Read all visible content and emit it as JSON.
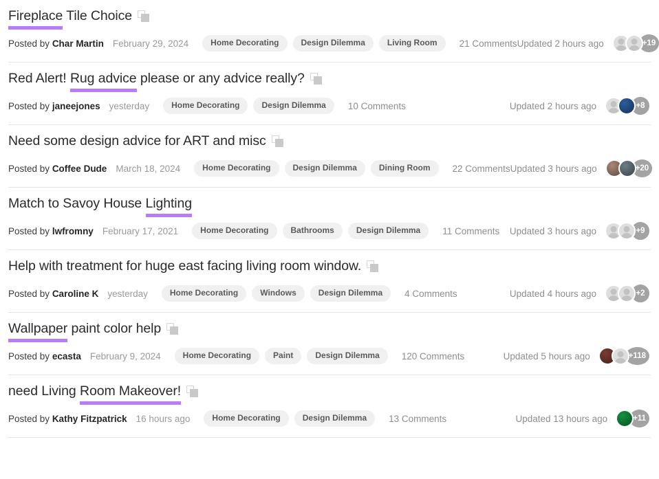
{
  "colors": {
    "highlight_underline": "#b97cf7",
    "tag_background": "#f0f0f0",
    "tag_text": "#5a5a5a",
    "muted_text": "#8e8e8e",
    "title_text": "#2b2b2b",
    "divider": "#e4e4e4",
    "avatar_placeholder": "#dedede",
    "more_count_background": "#a3a3a3"
  },
  "labels": {
    "posted_by_prefix": "Posted by",
    "copy_icon_name": "copy-icon"
  },
  "threads": [
    {
      "title_before": "",
      "title_highlight": "Fireplace",
      "title_after": " Tile Choice",
      "has_copy_icon": true,
      "author": "Char Martin",
      "date": "February 29, 2024",
      "tags": [
        "Home Decorating",
        "Design Dilemma",
        "Living Room"
      ],
      "comments": "21 Comments",
      "updated": "Updated 2 hours ago",
      "avatars": [
        {
          "type": "placeholder",
          "color": "#dedede"
        },
        {
          "type": "placeholder",
          "color": "#dedede"
        }
      ],
      "more_count": "+19"
    },
    {
      "title_before": "Red Alert! ",
      "title_highlight": "Rug advice",
      "title_after": " please or any advice really?",
      "has_copy_icon": true,
      "author": "janeejones",
      "date": "yesterday",
      "tags": [
        "Home Decorating",
        "Design Dilemma"
      ],
      "comments": "10 Comments",
      "updated": "Updated 2 hours ago",
      "avatars": [
        {
          "type": "placeholder",
          "color": "#dedede"
        },
        {
          "type": "photo",
          "color": "#2b5d9c"
        }
      ],
      "more_count": "+8"
    },
    {
      "title_before": "",
      "title_highlight": "",
      "title_after": "Need some design advice for ART and misc",
      "has_copy_icon": true,
      "author": "Coffee Dude",
      "date": "March 18, 2024",
      "tags": [
        "Home Decorating",
        "Design Dilemma",
        "Dining Room"
      ],
      "comments": "22 Comments",
      "updated": "Updated 3 hours ago",
      "avatars": [
        {
          "type": "photo",
          "color": "#a98875"
        },
        {
          "type": "photo",
          "color": "#6d7d84"
        }
      ],
      "more_count": "+20"
    },
    {
      "title_before": "Match to Savoy House ",
      "title_highlight": "Lighting",
      "title_after": "",
      "has_copy_icon": false,
      "author": "lwfromny",
      "date": "February 17, 2021",
      "tags": [
        "Home Decorating",
        "Bathrooms",
        "Design Dilemma"
      ],
      "comments": "11 Comments",
      "updated": "Updated 3 hours ago",
      "avatars": [
        {
          "type": "placeholder",
          "color": "#dedede"
        },
        {
          "type": "placeholder",
          "color": "#dedede"
        }
      ],
      "more_count": "+9"
    },
    {
      "title_before": "",
      "title_highlight": "",
      "title_after": "Help with treatment for huge east facing living room window.",
      "has_copy_icon": true,
      "author": "Caroline K",
      "date": "yesterday",
      "tags": [
        "Home Decorating",
        "Windows",
        "Design Dilemma"
      ],
      "comments": "4 Comments",
      "updated": "Updated 4 hours ago",
      "avatars": [
        {
          "type": "placeholder",
          "color": "#dedede"
        },
        {
          "type": "placeholder",
          "color": "#dedede"
        }
      ],
      "more_count": "+2"
    },
    {
      "title_before": "",
      "title_highlight": "Wallpaper",
      "title_after": " paint color help",
      "has_copy_icon": true,
      "author": "ecasta",
      "date": "February 9, 2024",
      "tags": [
        "Home Decorating",
        "Paint",
        "Design Dilemma"
      ],
      "comments": "120 Comments",
      "updated": "Updated 5 hours ago",
      "avatars": [
        {
          "type": "photo",
          "color": "#7a3b32"
        },
        {
          "type": "placeholder",
          "color": "#dedede"
        }
      ],
      "more_count": "+118"
    },
    {
      "title_before": "need Living ",
      "title_highlight": "Room Makeover!",
      "title_after": "",
      "has_copy_icon": true,
      "author": "Kathy Fitzpatrick",
      "date": "16 hours ago",
      "tags": [
        "Home Decorating",
        "Design Dilemma"
      ],
      "comments": "13 Comments",
      "updated": "Updated 13 hours ago",
      "avatars": [
        {
          "type": "photo",
          "color": "#15913f"
        }
      ],
      "more_count": "+11"
    }
  ]
}
